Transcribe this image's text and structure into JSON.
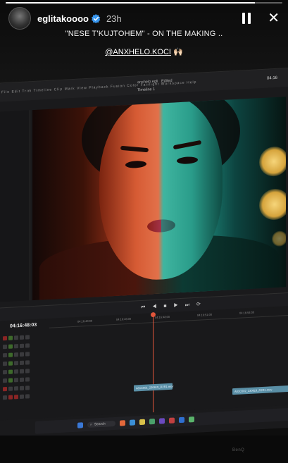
{
  "story": {
    "progress": 0.9,
    "username": "eglitakoooo",
    "time": "23h",
    "caption": "\"NESE T'KUJTOHEM\" - ON THE MAKING ..",
    "mention": "@ANXHELO.KOCI",
    "mention_emoji": "🙌🏻",
    "pause_icon": "pause-icon",
    "close_icon": "close-icon",
    "close_glyph": "✕"
  },
  "editor": {
    "menu": "File  Edit  Trim  Timeline  Clip  Mark  View  Playback  Fusion  Color  Fairlight  Workspace  Help",
    "project": "anxhelo egli",
    "project_status": "Edited",
    "timeline_name": "Timeline 1",
    "timecode": "04:16:48:03",
    "timecode_top": "04:16",
    "ruler": [
      "04:16:43:00",
      "04:16:46:00",
      "04:16:48:00",
      "04:16:51:00",
      "04:16:54:00"
    ],
    "clip1": "A01C001_230619_R2R1.mov",
    "clip2": "A01C002_230619_R2R1.mov",
    "taskbar_search": "Search",
    "monitor_brand": "BenQ"
  },
  "colors": {
    "accent": "#e0553b",
    "clip": "#5a8fa6",
    "verified": "#3897f0"
  }
}
